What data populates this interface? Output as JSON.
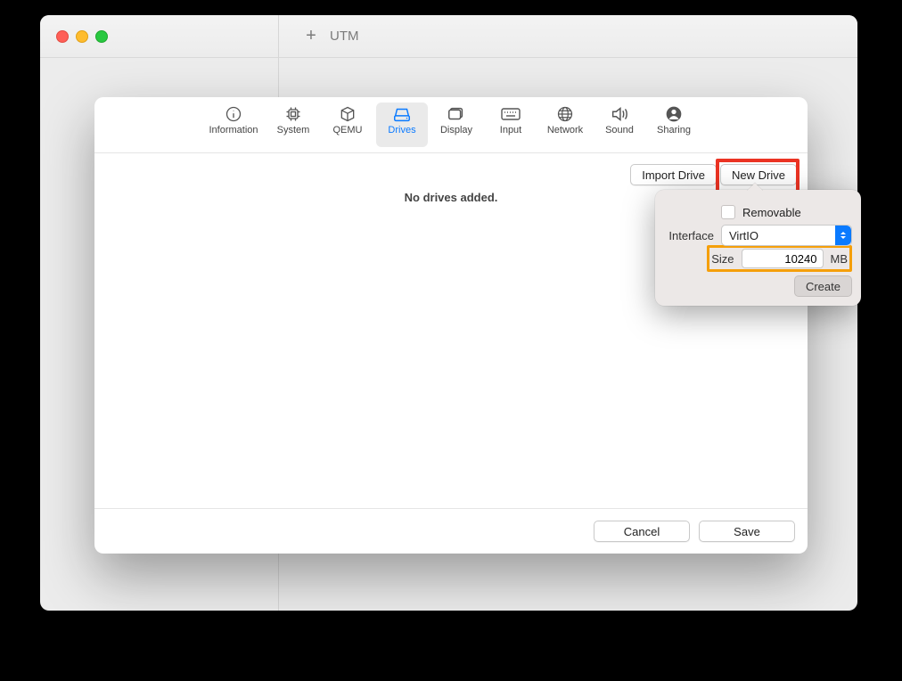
{
  "app": {
    "title": "UTM"
  },
  "tabs": [
    {
      "id": "information",
      "label": "Information"
    },
    {
      "id": "system",
      "label": "System"
    },
    {
      "id": "qemu",
      "label": "QEMU"
    },
    {
      "id": "drives",
      "label": "Drives"
    },
    {
      "id": "display",
      "label": "Display"
    },
    {
      "id": "input",
      "label": "Input"
    },
    {
      "id": "network",
      "label": "Network"
    },
    {
      "id": "sound",
      "label": "Sound"
    },
    {
      "id": "sharing",
      "label": "Sharing"
    }
  ],
  "selected_tab": "drives",
  "drives": {
    "import_label": "Import Drive",
    "new_label": "New Drive",
    "empty_message": "No drives added."
  },
  "popover": {
    "removable_label": "Removable",
    "removable_checked": false,
    "interface_label": "Interface",
    "interface_value": "VirtIO",
    "size_label": "Size",
    "size_value": "10240",
    "size_unit": "MB",
    "create_label": "Create"
  },
  "footer": {
    "cancel": "Cancel",
    "save": "Save"
  }
}
